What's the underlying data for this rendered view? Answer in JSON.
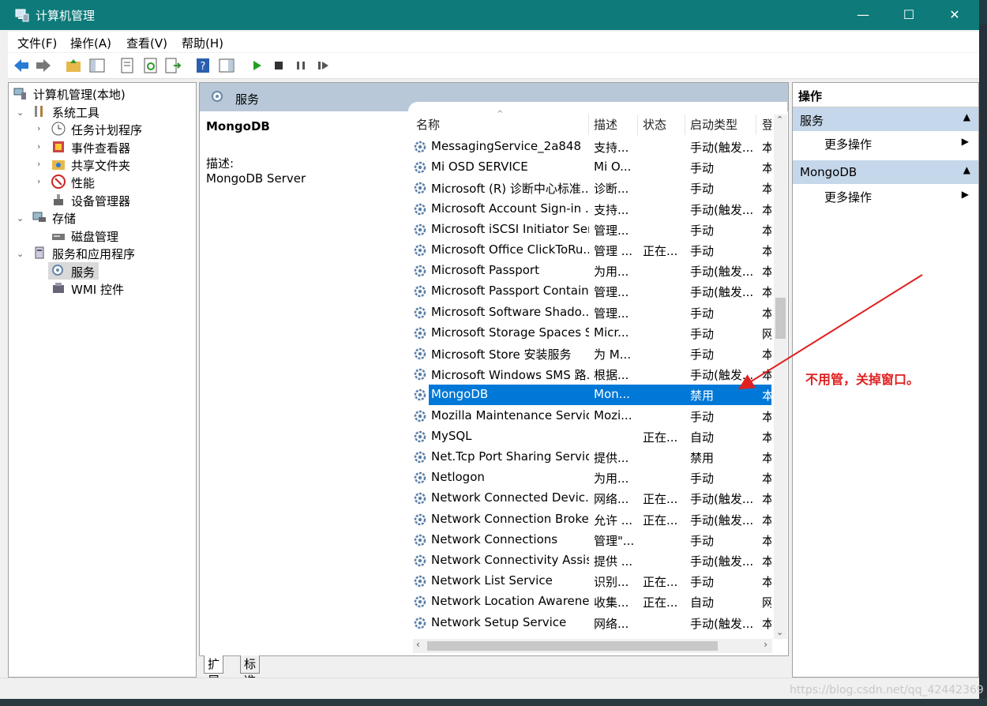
{
  "window": {
    "title": "计算机管理",
    "controls": {
      "minimize": "—",
      "maximize": "☐",
      "close": "✕"
    }
  },
  "menu": [
    "文件(F)",
    "操作(A)",
    "查看(V)",
    "帮助(H)"
  ],
  "tree": {
    "root": "计算机管理(本地)",
    "system_tools": "系统工具",
    "task_scheduler": "任务计划程序",
    "event_viewer": "事件查看器",
    "shared_folders": "共享文件夹",
    "performance": "性能",
    "device_manager": "设备管理器",
    "storage": "存储",
    "disk_management": "磁盘管理",
    "services_apps": "服务和应用程序",
    "services": "服务",
    "wmi": "WMI 控件"
  },
  "center": {
    "header": "服务",
    "detail_name": "MongoDB",
    "detail_desc_label": "描述:",
    "detail_desc": "MongoDB Server",
    "columns": {
      "name": "名称",
      "desc": "描述",
      "status": "状态",
      "startup": "启动类型",
      "logon": "登"
    }
  },
  "services": [
    {
      "name": "MessagingService_2a848",
      "desc": "支持...",
      "status": "",
      "startup": "手动(触发...",
      "logon": "本"
    },
    {
      "name": "Mi OSD SERVICE",
      "desc": "Mi O...",
      "status": "",
      "startup": "手动",
      "logon": "本"
    },
    {
      "name": "Microsoft (R) 诊断中心标准...",
      "desc": "诊断...",
      "status": "",
      "startup": "手动",
      "logon": "本"
    },
    {
      "name": "Microsoft Account Sign-in ...",
      "desc": "支持...",
      "status": "",
      "startup": "手动(触发...",
      "logon": "本"
    },
    {
      "name": "Microsoft iSCSI Initiator Ser...",
      "desc": "管理...",
      "status": "",
      "startup": "手动",
      "logon": "本"
    },
    {
      "name": "Microsoft Office ClickToRu...",
      "desc": "管理 ...",
      "status": "正在...",
      "startup": "手动",
      "logon": "本"
    },
    {
      "name": "Microsoft Passport",
      "desc": "为用...",
      "status": "",
      "startup": "手动(触发...",
      "logon": "本"
    },
    {
      "name": "Microsoft Passport Container",
      "desc": "管理...",
      "status": "",
      "startup": "手动(触发...",
      "logon": "本"
    },
    {
      "name": "Microsoft Software Shado...",
      "desc": "管理...",
      "status": "",
      "startup": "手动",
      "logon": "本"
    },
    {
      "name": "Microsoft Storage Spaces S...",
      "desc": "Micr...",
      "status": "",
      "startup": "手动",
      "logon": "网"
    },
    {
      "name": "Microsoft Store 安装服务",
      "desc": "为 M...",
      "status": "",
      "startup": "手动",
      "logon": "本"
    },
    {
      "name": "Microsoft Windows SMS 路...",
      "desc": "根据...",
      "status": "",
      "startup": "手动(触发...",
      "logon": "本"
    },
    {
      "name": "MongoDB",
      "desc": "Mon...",
      "status": "",
      "startup": "禁用",
      "logon": "本"
    },
    {
      "name": "Mozilla Maintenance Service",
      "desc": "Mozi...",
      "status": "",
      "startup": "手动",
      "logon": "本"
    },
    {
      "name": "MySQL",
      "desc": "",
      "status": "正在...",
      "startup": "自动",
      "logon": "本"
    },
    {
      "name": "Net.Tcp Port Sharing Service",
      "desc": "提供...",
      "status": "",
      "startup": "禁用",
      "logon": "本"
    },
    {
      "name": "Netlogon",
      "desc": "为用...",
      "status": "",
      "startup": "手动",
      "logon": "本"
    },
    {
      "name": "Network Connected Devic...",
      "desc": "网络...",
      "status": "正在...",
      "startup": "手动(触发...",
      "logon": "本"
    },
    {
      "name": "Network Connection Broker",
      "desc": "允许 ...",
      "status": "正在...",
      "startup": "手动(触发...",
      "logon": "本"
    },
    {
      "name": "Network Connections",
      "desc": "管理\"...",
      "status": "",
      "startup": "手动",
      "logon": "本"
    },
    {
      "name": "Network Connectivity Assis...",
      "desc": "提供 ...",
      "status": "",
      "startup": "手动(触发...",
      "logon": "本"
    },
    {
      "name": "Network List Service",
      "desc": "识别...",
      "status": "正在...",
      "startup": "手动",
      "logon": "本"
    },
    {
      "name": "Network Location Awarene...",
      "desc": "收集...",
      "status": "正在...",
      "startup": "自动",
      "logon": "网"
    },
    {
      "name": "Network Setup Service",
      "desc": "网络...",
      "status": "",
      "startup": "手动(触发...",
      "logon": "本"
    }
  ],
  "selected_service": "MongoDB",
  "tabs": [
    "扩展",
    "标准"
  ],
  "actions": {
    "title": "操作",
    "sec1": "服务",
    "sec1_more": "更多操作",
    "sec2": "MongoDB",
    "sec2_more": "更多操作"
  },
  "annotation": "不用管，关掉窗口。",
  "watermark": "https://blog.csdn.net/qq_42442369",
  "colors": {
    "titlebar": "#0e7a7a",
    "selection": "#0078d7",
    "annotation": "#e02020",
    "section": "#c5d7ea"
  }
}
